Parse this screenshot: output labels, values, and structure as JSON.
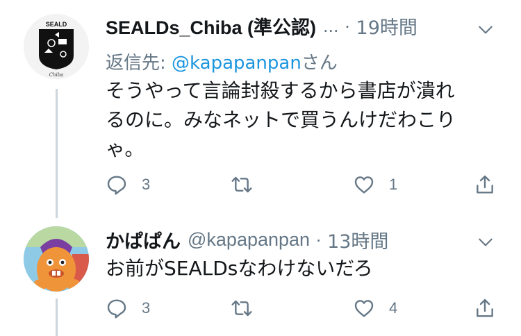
{
  "tweets": [
    {
      "name": "SEALDs_Chiba (準公認)",
      "ellipsis": "...",
      "separator": "·",
      "time": "19時間",
      "reply_prefix": "返信先: ",
      "reply_mention": "@kapapanpan",
      "reply_suffix": "さん",
      "text_lines": [
        "そうやって言論封殺するから書店が潰れ",
        "るのに。みなネットで買うんけだわこり",
        "ゃ。"
      ],
      "reply_count": "3",
      "retweet_count": "",
      "like_count": "1",
      "avatar": {
        "logo_text": "SEALD",
        "sub_text": "Chiba"
      }
    },
    {
      "name": "かぱぱん",
      "handle": "@kapapanpan",
      "separator": "·",
      "time": "13時間",
      "text": "お前がSEALDsなわけないだろ",
      "reply_count": "3",
      "retweet_count": "",
      "like_count": "4"
    }
  ],
  "icons": {
    "reply": "reply-icon",
    "retweet": "retweet-icon",
    "like": "heart-icon",
    "share": "share-icon",
    "menu": "chevron-down-icon"
  },
  "colors": {
    "text": "#14171a",
    "secondary": "#657786",
    "link": "#1b95e0",
    "thread_line": "#ccd6dd"
  }
}
